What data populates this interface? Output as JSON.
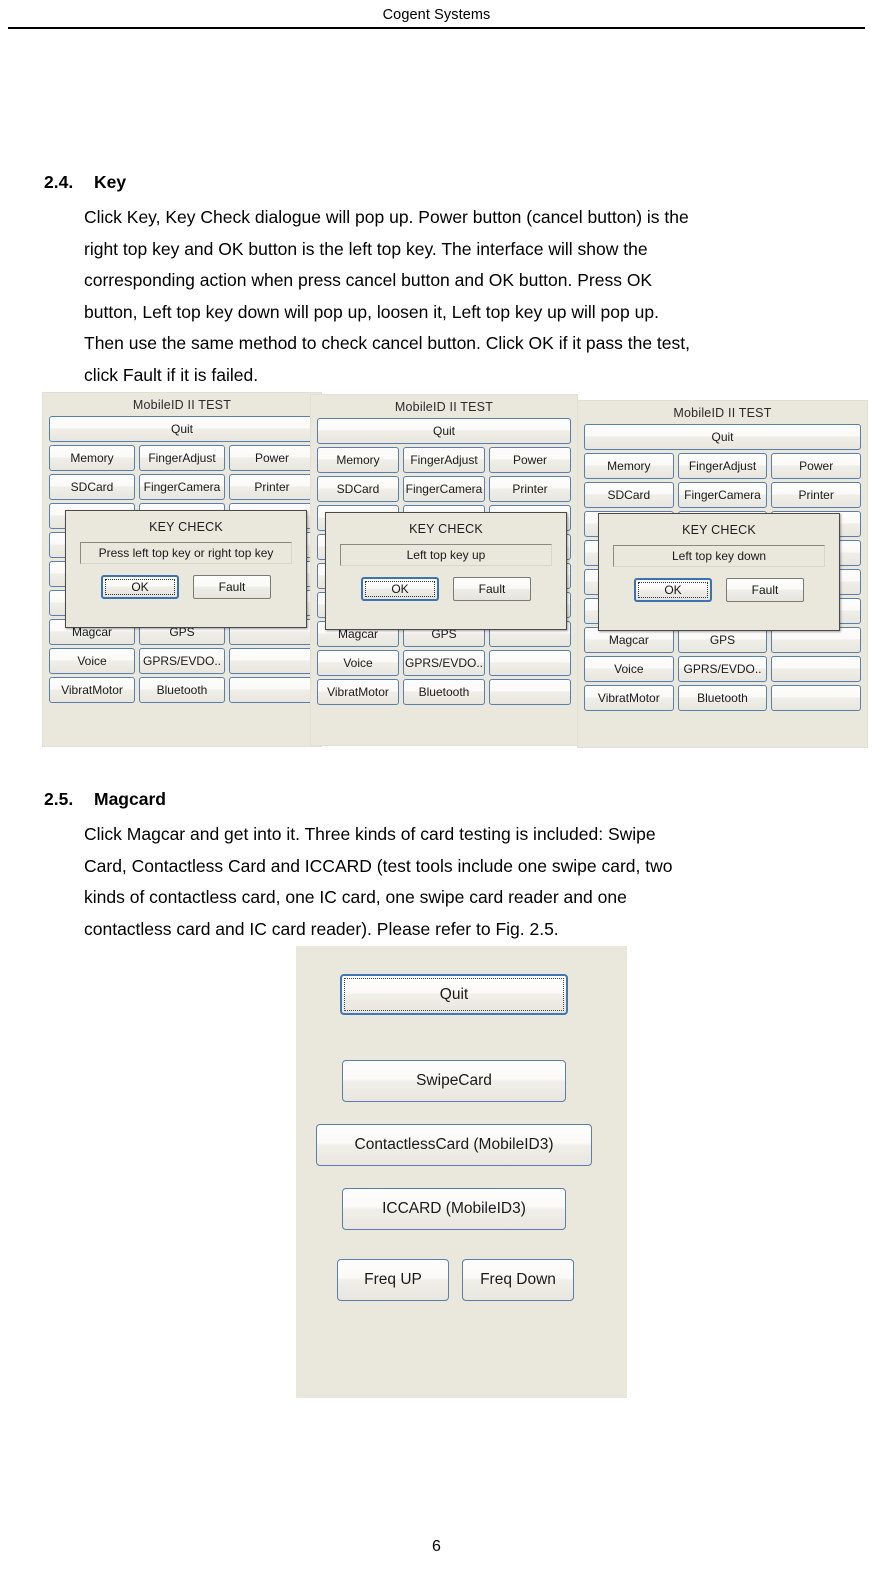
{
  "header": {
    "title": "Cogent Systems"
  },
  "footer": {
    "page_number": "6"
  },
  "sections": {
    "key": {
      "number": "2.4.",
      "title": "Key",
      "paragraph_lines": [
        "Click Key, Key Check dialogue will pop up. Power button (cancel button) is the",
        "right top key and OK button is the left top key. The interface will show the",
        "corresponding action when press cancel button and OK button. Press OK",
        "button, Left top key down will pop up, loosen it, Left top key up will pop up.",
        "Then use the same method to check cancel button. Click OK if it pass the test,",
        "click Fault if it is failed."
      ]
    },
    "magcard": {
      "number": "2.5.",
      "title": "Magcard",
      "paragraph_lines": [
        "Click Magcar and get into it. Three kinds of card testing is included: Swipe",
        "Card, Contactless Card and ICCARD (test tools include one swipe card, two",
        "kinds of contactless card, one IC card, one swipe card reader and one",
        "contactless card and IC card reader). Please refer to Fig. 2.5."
      ]
    }
  },
  "figure_key": {
    "panels": [
      {
        "title": "MobileID II TEST",
        "quit_label": "Quit",
        "grid_rows": [
          [
            "Memory",
            "FingerAdjust",
            "Power"
          ],
          [
            "SDCard",
            "FingerCamera",
            "Printer"
          ],
          [
            "",
            "",
            ""
          ],
          [
            "",
            "",
            ""
          ],
          [
            "",
            "",
            ""
          ],
          [
            "",
            "",
            ""
          ],
          [
            "Magcar",
            "GPS",
            ""
          ],
          [
            "Voice",
            "GPRS/EVDO..",
            ""
          ],
          [
            "VibratMotor",
            "Bluetooth",
            ""
          ]
        ],
        "dialog": {
          "title": "KEY CHECK",
          "message": "Press left top key or right top key",
          "ok_label": "OK",
          "fault_label": "Fault"
        }
      },
      {
        "title": "MobileID II TEST",
        "quit_label": "Quit",
        "grid_rows": [
          [
            "Memory",
            "FingerAdjust",
            "Power"
          ],
          [
            "SDCard",
            "FingerCamera",
            "Printer"
          ],
          [
            "",
            "",
            ""
          ],
          [
            "",
            "",
            ""
          ],
          [
            "",
            "",
            ""
          ],
          [
            "",
            "",
            ""
          ],
          [
            "Magcar",
            "GPS",
            ""
          ],
          [
            "Voice",
            "GPRS/EVDO..",
            ""
          ],
          [
            "VibratMotor",
            "Bluetooth",
            ""
          ]
        ],
        "dialog": {
          "title": "KEY CHECK",
          "message": "Left top key up",
          "ok_label": "OK",
          "fault_label": "Fault"
        }
      },
      {
        "title": "MobileID II TEST",
        "quit_label": "Quit",
        "grid_rows": [
          [
            "Memory",
            "FingerAdjust",
            "Power"
          ],
          [
            "SDCard",
            "FingerCamera",
            "Printer"
          ],
          [
            "",
            "",
            ""
          ],
          [
            "",
            "",
            ""
          ],
          [
            "",
            "",
            ""
          ],
          [
            "",
            "",
            ""
          ],
          [
            "Magcar",
            "GPS",
            ""
          ],
          [
            "Voice",
            "GPRS/EVDO..",
            ""
          ],
          [
            "VibratMotor",
            "Bluetooth",
            ""
          ]
        ],
        "dialog": {
          "title": "KEY CHECK",
          "message": "Left top key down",
          "ok_label": "OK",
          "fault_label": "Fault"
        }
      }
    ]
  },
  "figure_magcard": {
    "quit_label": "Quit",
    "buttons": [
      "SwipeCard",
      "ContactlessCard (MobileID3)",
      "ICCARD (MobileID3)"
    ],
    "freq_up_label": "Freq UP",
    "freq_down_label": "Freq Down"
  },
  "colors": {
    "panel_bg": "#eae7dc",
    "button_border": "#5b7fad",
    "focus_border": "#3f76b4",
    "dialog_border": "#4a4a4a"
  }
}
